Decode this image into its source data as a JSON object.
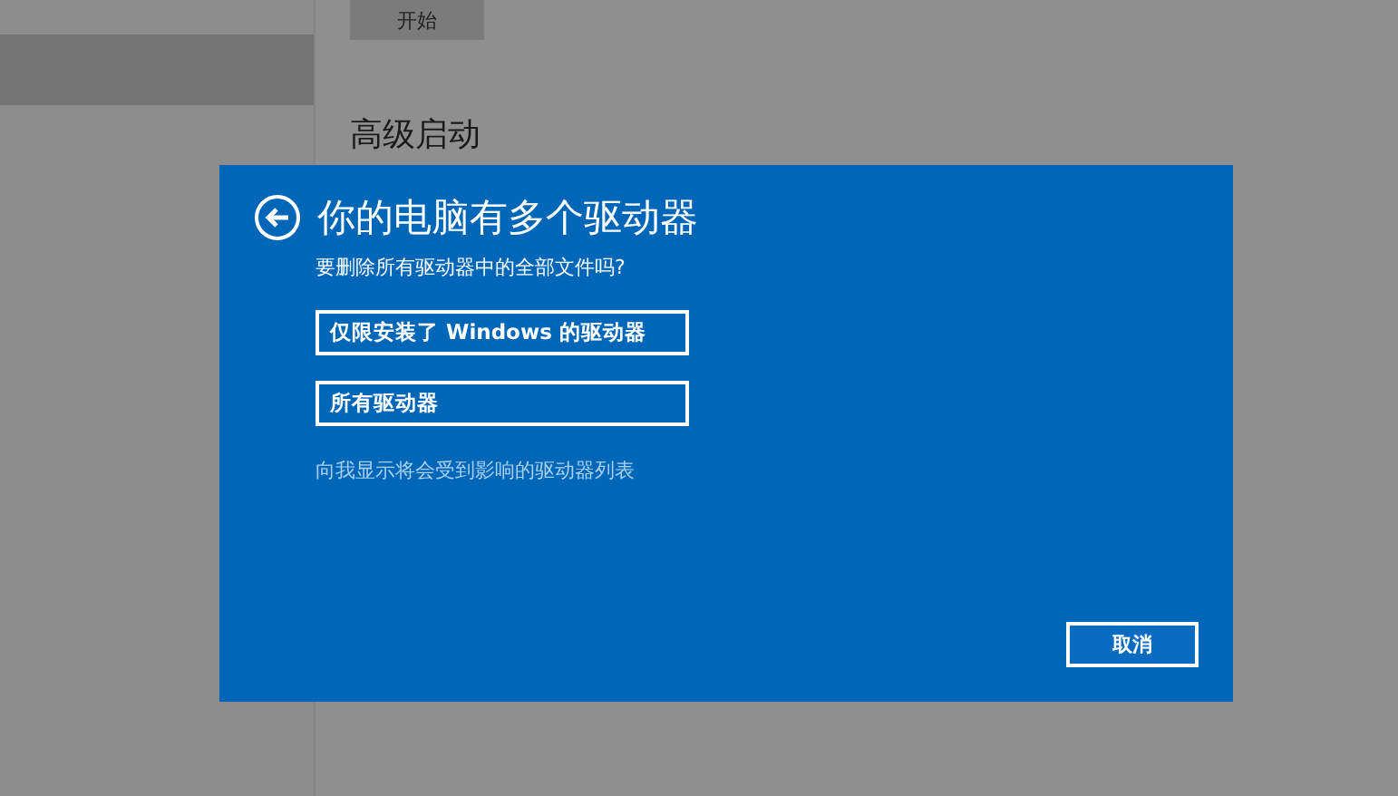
{
  "settings": {
    "start_button": "开始",
    "heading": "高级启动"
  },
  "dialog": {
    "title": "你的电脑有多个驱动器",
    "question": "要删除所有驱动器中的全部文件吗?",
    "options": [
      {
        "label": "仅限安装了 Windows 的驱动器"
      },
      {
        "label": "所有驱动器"
      }
    ],
    "link": "向我显示将会受到影响的驱动器列表",
    "cancel_button": "取消"
  }
}
